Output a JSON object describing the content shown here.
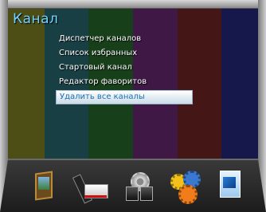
{
  "screen": {
    "title": "Канал",
    "bar_colors": [
      "#5a5a1a",
      "#1f4a4a",
      "#1d4a1d",
      "#4a1d4a",
      "#4a1a1a",
      "#1a1a4a"
    ]
  },
  "menu": {
    "items": [
      {
        "label": "Диспетчер каналов",
        "selected": false
      },
      {
        "label": "Список избранных",
        "selected": false
      },
      {
        "label": "Стартовый канал",
        "selected": false
      },
      {
        "label": "Редактор фаворитов",
        "selected": false
      },
      {
        "label": "Удалить все каналы",
        "selected": true
      }
    ],
    "selected_text_color": "#1a6fb0",
    "accent": "#6fd3ff"
  },
  "bottom_icons": [
    {
      "name": "media-icon"
    },
    {
      "name": "recorder-icon"
    },
    {
      "name": "binoculars-icon"
    },
    {
      "name": "gears-icon"
    },
    {
      "name": "settings-document-icon"
    }
  ]
}
